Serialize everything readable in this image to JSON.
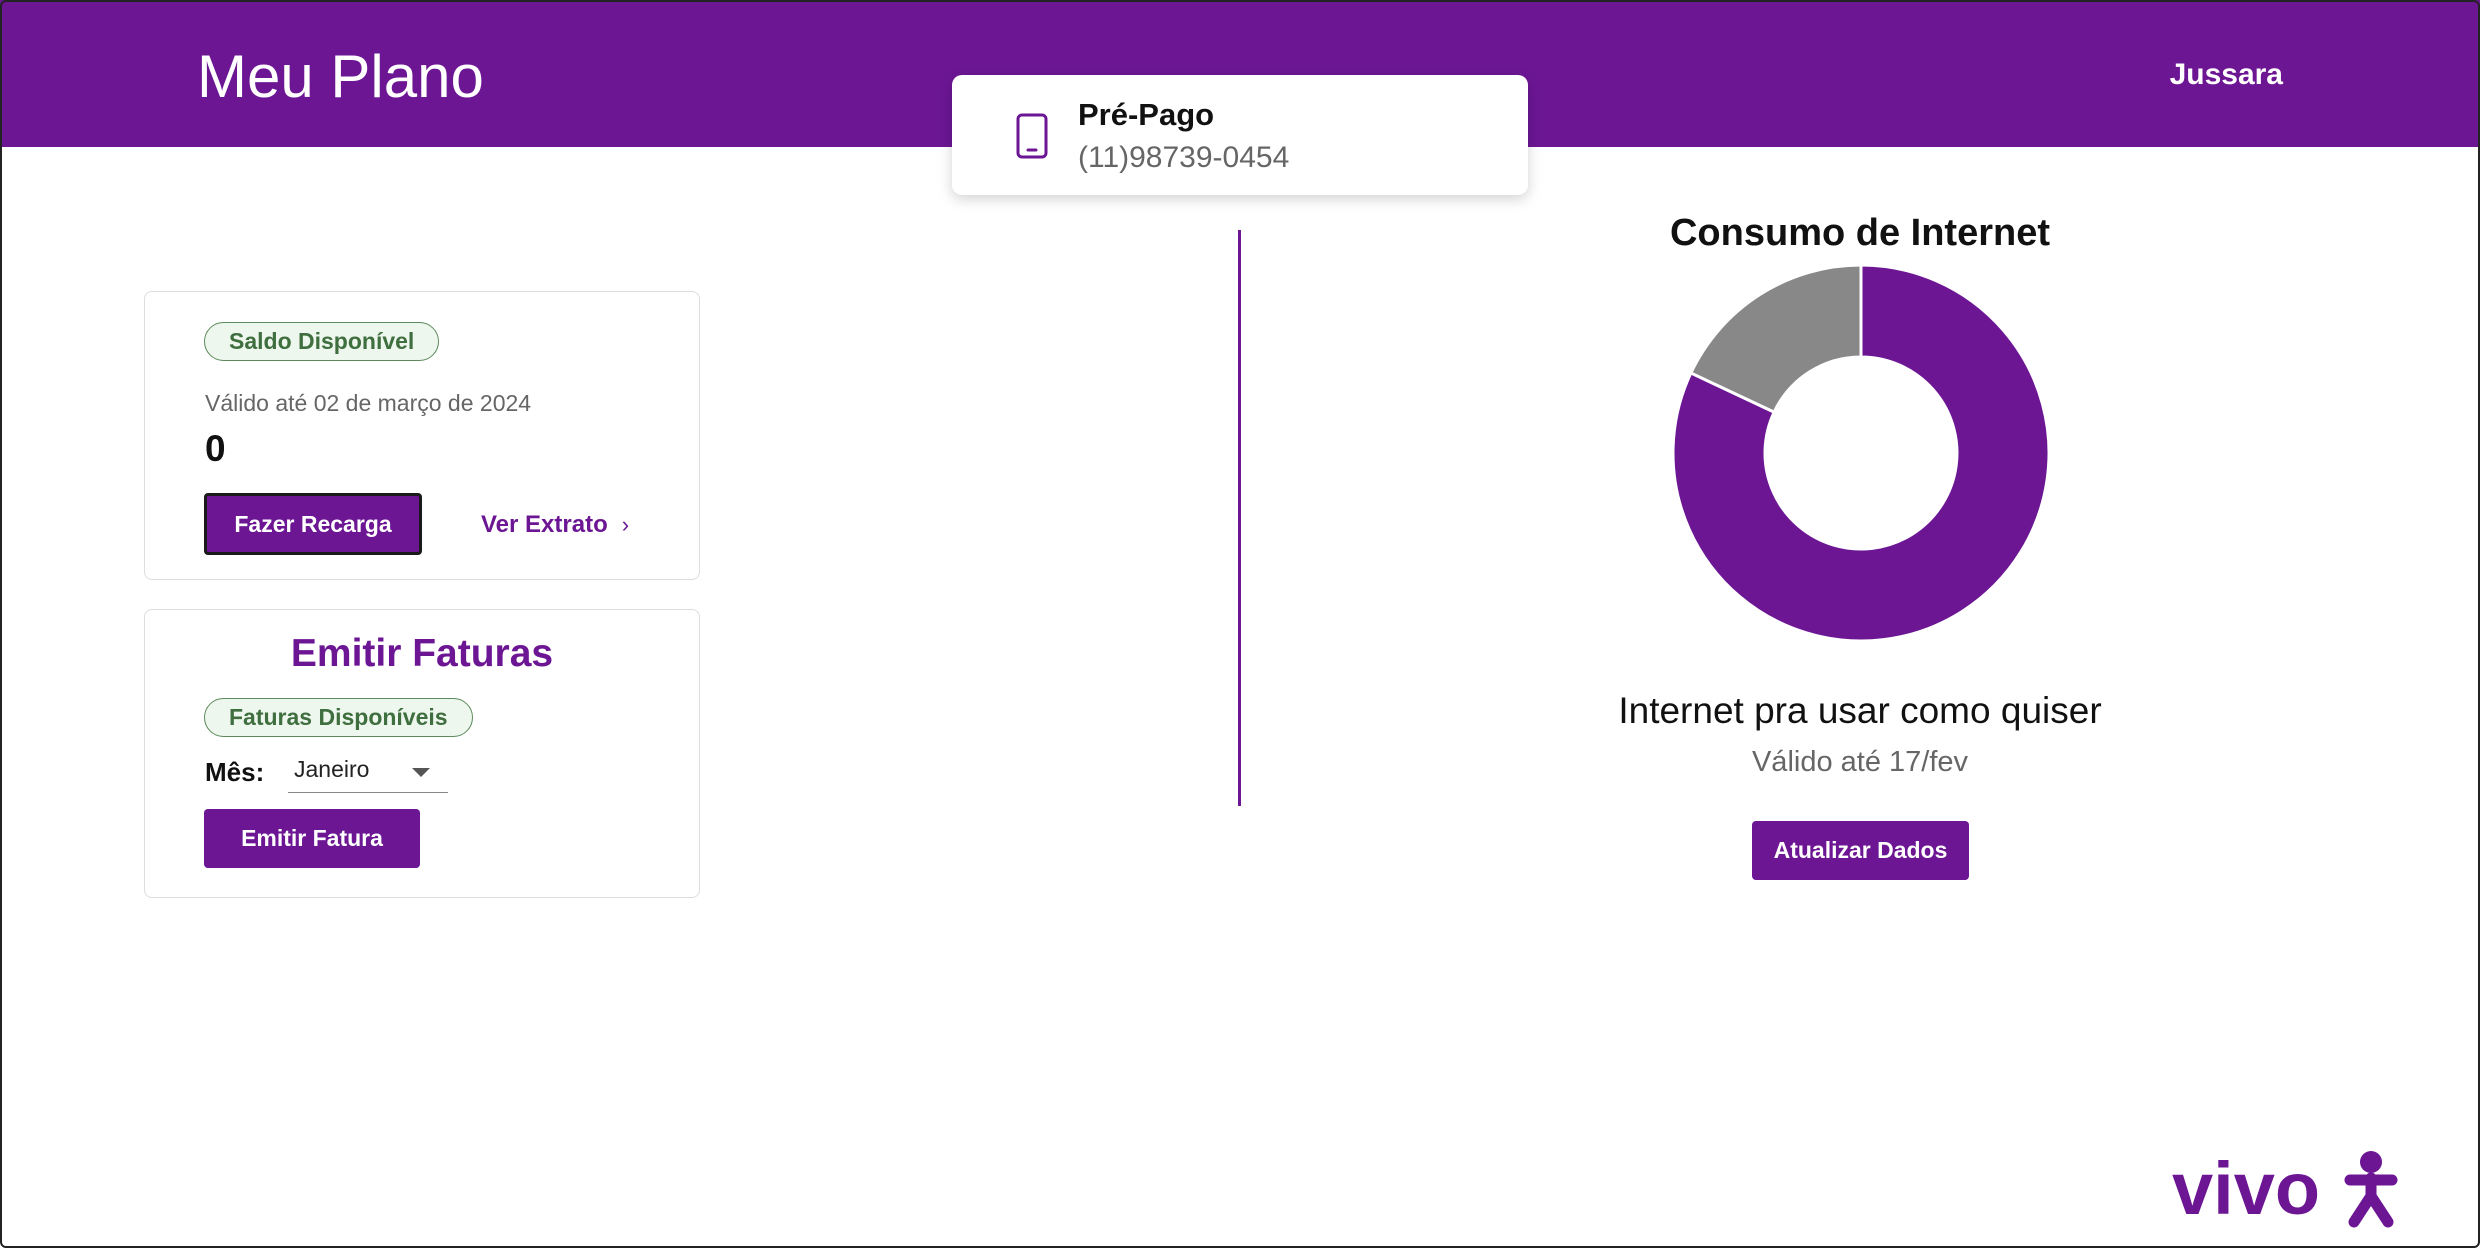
{
  "header": {
    "title": "Meu Plano",
    "user": "Jussara",
    "bg_color": "#6c1694"
  },
  "plan": {
    "icon": "smartphone-icon",
    "name": "Pré-Pago",
    "number": "(11)98739-0454"
  },
  "saldo": {
    "badge": "Saldo Disponível",
    "validity": "Válido até 02 de março de 2024",
    "value": "0",
    "recharge_button": "Fazer Recarga",
    "statement_link": "Ver Extrato"
  },
  "faturas": {
    "title": "Emitir Faturas",
    "badge": "Faturas Disponíveis",
    "month_label": "Mês:",
    "month_selected": "Janeiro",
    "emit_button": "Emitir Fatura"
  },
  "internet": {
    "title": "Consumo de Internet",
    "label": "Internet pra usar como quiser",
    "validity": "Válido até 17/fev",
    "update_button": "Atualizar Dados"
  },
  "chart_data": {
    "type": "pie",
    "title": "Consumo de Internet",
    "series": [
      {
        "value": 82,
        "color": "#6c1694"
      },
      {
        "value": 18,
        "color": "#888888"
      }
    ]
  },
  "logo": {
    "text": "vivo",
    "color": "#6c1694"
  }
}
